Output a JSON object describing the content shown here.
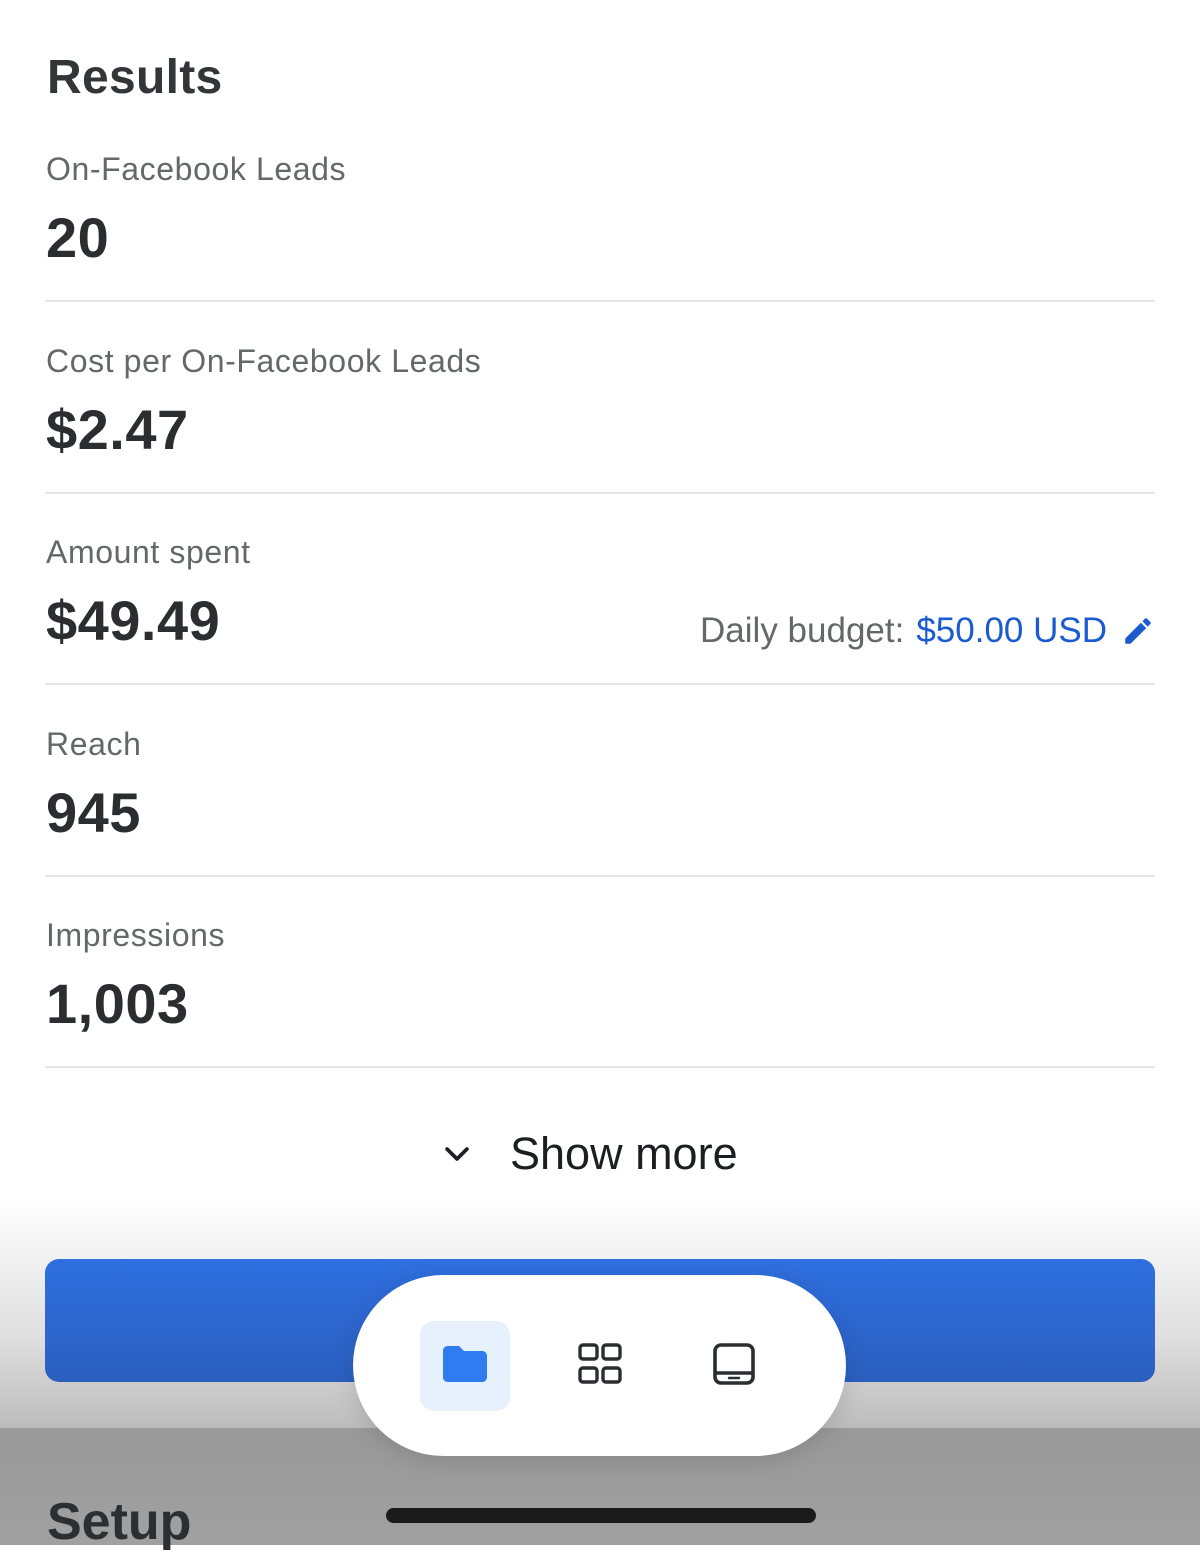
{
  "results": {
    "title": "Results",
    "metrics": [
      {
        "label": "On-Facebook Leads",
        "value": "20"
      },
      {
        "label": "Cost per On-Facebook Leads",
        "value": "$2.47"
      },
      {
        "label": "Amount spent",
        "value": "$49.49"
      },
      {
        "label": "Reach",
        "value": "945"
      },
      {
        "label": "Impressions",
        "value": "1,003"
      }
    ],
    "daily_budget": {
      "label": "Daily budget:",
      "value": "$50.00 USD",
      "icon": "pencil-edit-icon"
    },
    "show_more": {
      "label": "Show more",
      "icon": "chevron-down-icon"
    }
  },
  "setup": {
    "title": "Setup"
  },
  "tabbar": {
    "tabs": [
      {
        "icon": "folder-icon",
        "active": true
      },
      {
        "icon": "grid-icon",
        "active": false
      },
      {
        "icon": "tablet-icon",
        "active": false
      }
    ]
  },
  "colors": {
    "accent": "#1a5bd0",
    "button": "#2f6fe0",
    "label": "#65676b",
    "value": "#2b2d30",
    "active_tab_bg": "#e7f0fd"
  }
}
